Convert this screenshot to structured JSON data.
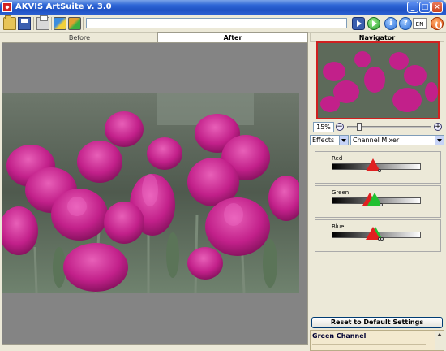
{
  "window": {
    "title": "AKVIS ArtSuite v. 3.0"
  },
  "toolbar": {
    "buttons": [
      "open-icon",
      "save-icon",
      "print-icon",
      "brush-icon",
      "brush-settings-icon",
      "play-icon",
      "run-icon",
      "info-icon",
      "help-icon",
      "exit-icon"
    ],
    "language": "EN",
    "progress_value": 0
  },
  "tabs": {
    "before": "Before",
    "after": "After",
    "active": "After"
  },
  "navigator": {
    "header": "Navigator",
    "zoom": "15%",
    "zoom_slider_fraction": 0.12
  },
  "effects": {
    "category": "Effects",
    "effect": "Channel Mixer"
  },
  "channels": [
    {
      "label": "Red",
      "markers": [
        {
          "color": "#e02020",
          "value": 0.46
        }
      ]
    },
    {
      "label": "Green",
      "markers": [
        {
          "color": "#e02020",
          "value": 0.43
        },
        {
          "color": "#20c030",
          "value": 0.48
        }
      ]
    },
    {
      "label": "Blue",
      "markers": [
        {
          "color": "#20c030",
          "value": 0.49
        },
        {
          "color": "#e02020",
          "value": 0.46
        }
      ]
    }
  ],
  "reset_label": "Reset to Default Settings",
  "help": {
    "title": "Green Channel"
  },
  "colors": {
    "accent": "#d02020",
    "flower": "#c8208a",
    "titlebar": "#1f52c4"
  }
}
